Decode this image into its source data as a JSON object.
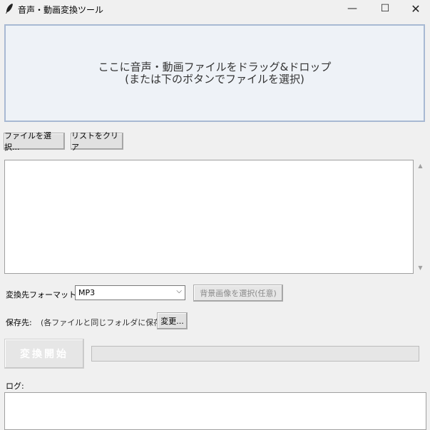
{
  "window": {
    "title": "音声・動画変換ツール",
    "controls": {
      "minimize": "—",
      "maximize": "☐",
      "close": "✕"
    }
  },
  "dropzone": {
    "line1": "ここに音声・動画ファイルをドラッグ&ドロップ",
    "line2": "(または下のボタンでファイルを選択)"
  },
  "file_buttons": {
    "select_label": "ファイルを選択...",
    "clear_label": "リストをクリア"
  },
  "file_list": {
    "items": []
  },
  "format": {
    "label": "変換先フォーマット:",
    "selected": "MP3",
    "bg_image_button": "背景画像を選択(任意)"
  },
  "save": {
    "label": "保存先:",
    "path": "(各ファイルと同じフォルダに保存)",
    "change_button": "変更..."
  },
  "convert": {
    "start_label": "変換開始",
    "progress": 0
  },
  "log": {
    "label": "ログ:",
    "content": ""
  },
  "icons": {
    "app": "feather-icon",
    "dropdown": "chevron-down-icon",
    "scroll_up": "triangle-up-icon",
    "scroll_down": "triangle-down-icon"
  },
  "colors": {
    "dropzone_bg": "#eef2f7",
    "dropzone_border": "#a8b9d3"
  }
}
